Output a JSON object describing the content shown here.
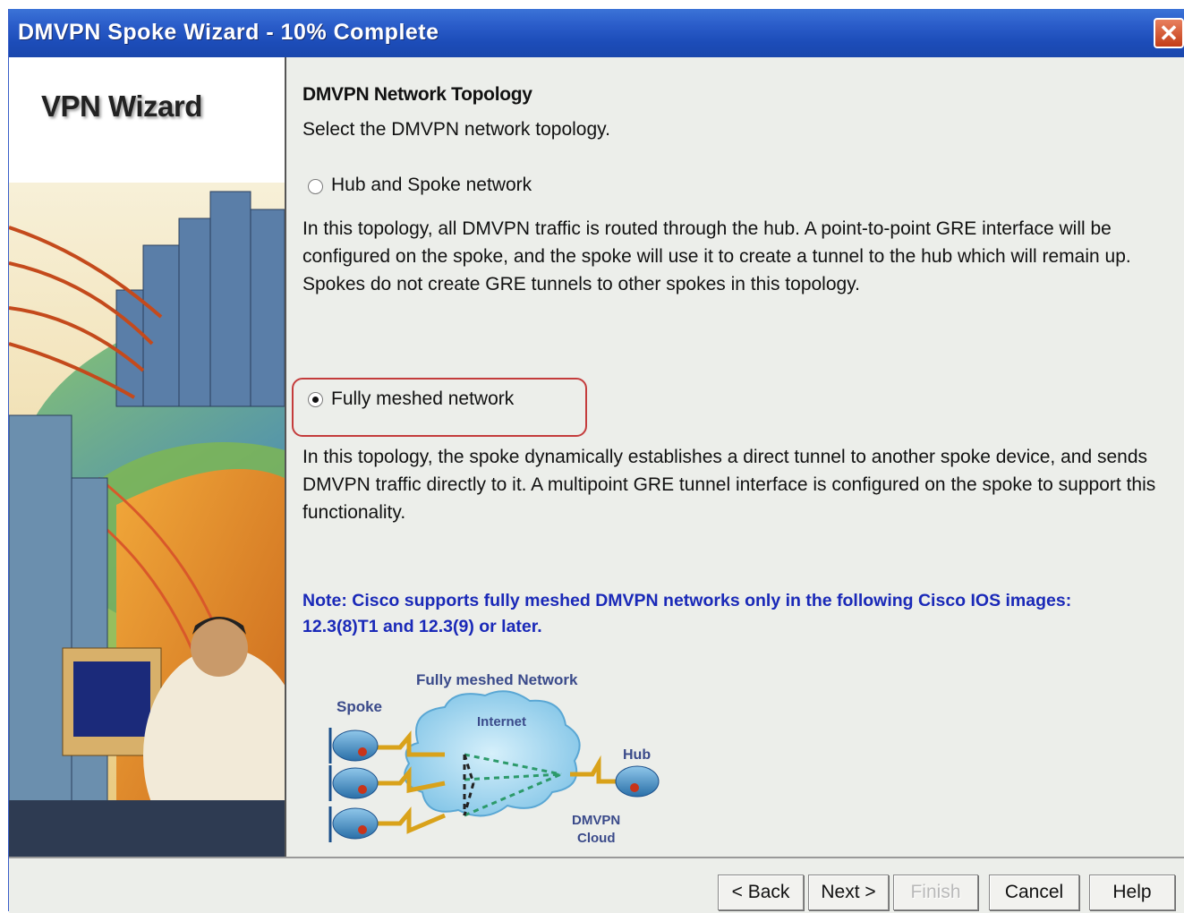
{
  "window": {
    "title": "DMVPN Spoke Wizard - 10% Complete",
    "close_glyph": "✕"
  },
  "sidebar": {
    "title": "VPN Wizard"
  },
  "content": {
    "heading": "DMVPN Network Topology",
    "subheading": "Select the DMVPN network topology.",
    "options": [
      {
        "label": "Hub and Spoke network",
        "selected": false,
        "description": "In this topology, all DMVPN traffic is routed through the hub. A point-to-point GRE interface will be configured on the spoke, and the spoke will use it to create a tunnel to the hub which will remain up. Spokes do not create GRE tunnels to other spokes in this topology."
      },
      {
        "label": "Fully meshed network",
        "selected": true,
        "description": "In this topology, the spoke dynamically establishes a direct tunnel  to another spoke device, and sends DMVPN traffic directly to it. A multipoint GRE tunnel interface is configured on the spoke to support this functionality."
      }
    ],
    "note": "Note: Cisco supports fully meshed DMVPN networks only in the following Cisco IOS images: 12.3(8)T1 and 12.3(9) or later."
  },
  "diagram": {
    "title": "Fully meshed Network",
    "spoke_label": "Spoke",
    "internet_label": "Internet",
    "hub_label": "Hub",
    "cloud_label_line1": "DMVPN",
    "cloud_label_line2": "Cloud"
  },
  "buttons": {
    "back": "< Back",
    "next": "Next >",
    "finish": "Finish",
    "cancel": "Cancel",
    "help": "Help"
  },
  "colors": {
    "title_bar": "#2a5cc9",
    "note_text": "#1a29b8",
    "highlight_border": "#c43c3c"
  }
}
